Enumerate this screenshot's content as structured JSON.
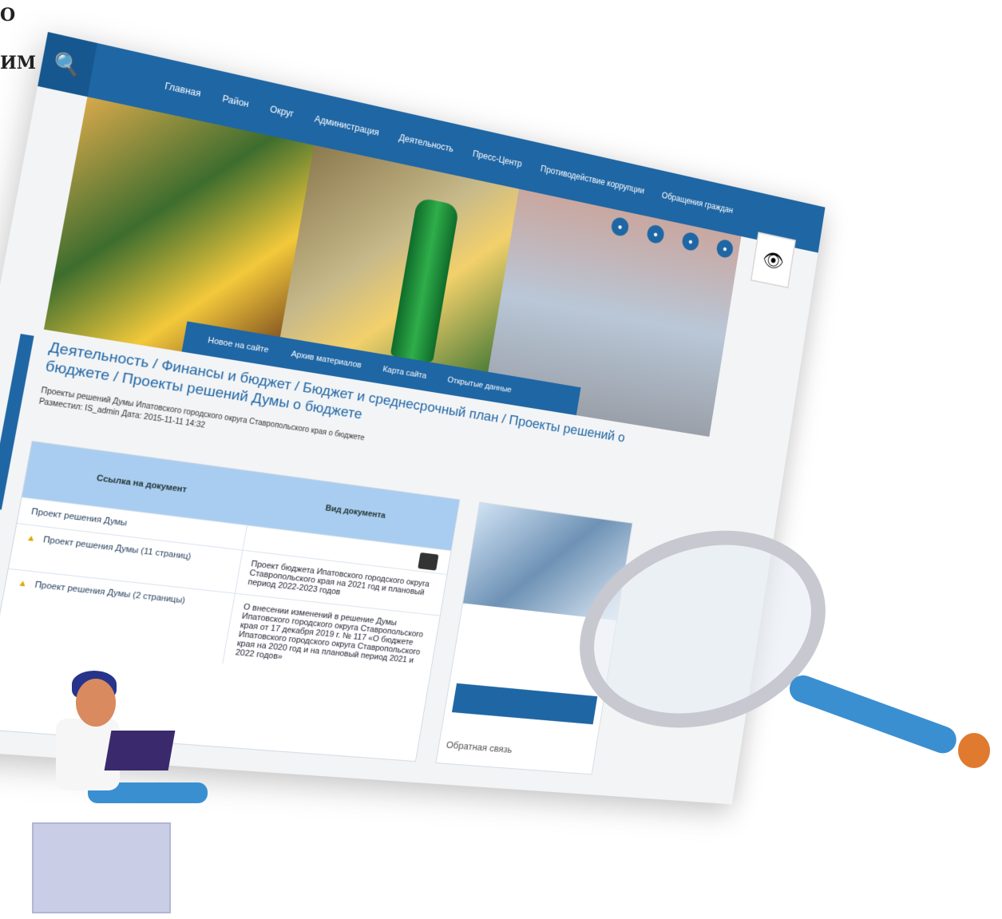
{
  "corner": {
    "line1": "О",
    "line2": "ИМ"
  },
  "header": {
    "nav": [
      "Главная",
      "Район",
      "Округ",
      "Администрация",
      "Деятельность",
      "Пресс-Центр",
      "Противодействие коррупции",
      "Обращения граждан"
    ]
  },
  "subnav": [
    "Новое на сайте",
    "Архив материалов",
    "Карта сайта",
    "Открытые данные"
  ],
  "breadcrumb": "Деятельность / Финансы и бюджет / Бюджет и среднесрочный план / Проекты решений о бюджете / Проекты решений Думы о бюджете",
  "doc_meta": {
    "line1": "Проекты решений Думы Ипатовского городского округа Ставропольского края о бюджете",
    "line2": "Разместил: IS_admin  Дата: 2015-11-11 14:32"
  },
  "table": {
    "headers": [
      "Ссылка на документ",
      "Вид документа"
    ],
    "rows": [
      {
        "left": "Проект решения Думы",
        "right": ""
      },
      {
        "left": "Проект решения Думы (11 страниц)",
        "right": "Проект бюджета Ипатовского городского округа Ставропольского края на 2021 год и плановый период 2022-2023 годов"
      },
      {
        "left": "Проект решения Думы (2 страницы)",
        "right": "О внесении изменений в решение Думы Ипатовского городского округа Ставропольского края от 17 декабря 2019 г. № 117 «О бюджете Ипатовского городского округа Ставропольского края на 2020 год и на плановый период 2021 и 2022 годов»"
      }
    ]
  },
  "sidebar": {
    "feedback": "Обратная связь"
  },
  "icons": {
    "search": "search-icon",
    "eye": "eye-icon",
    "print": "print-icon",
    "warn": "warning-icon"
  }
}
